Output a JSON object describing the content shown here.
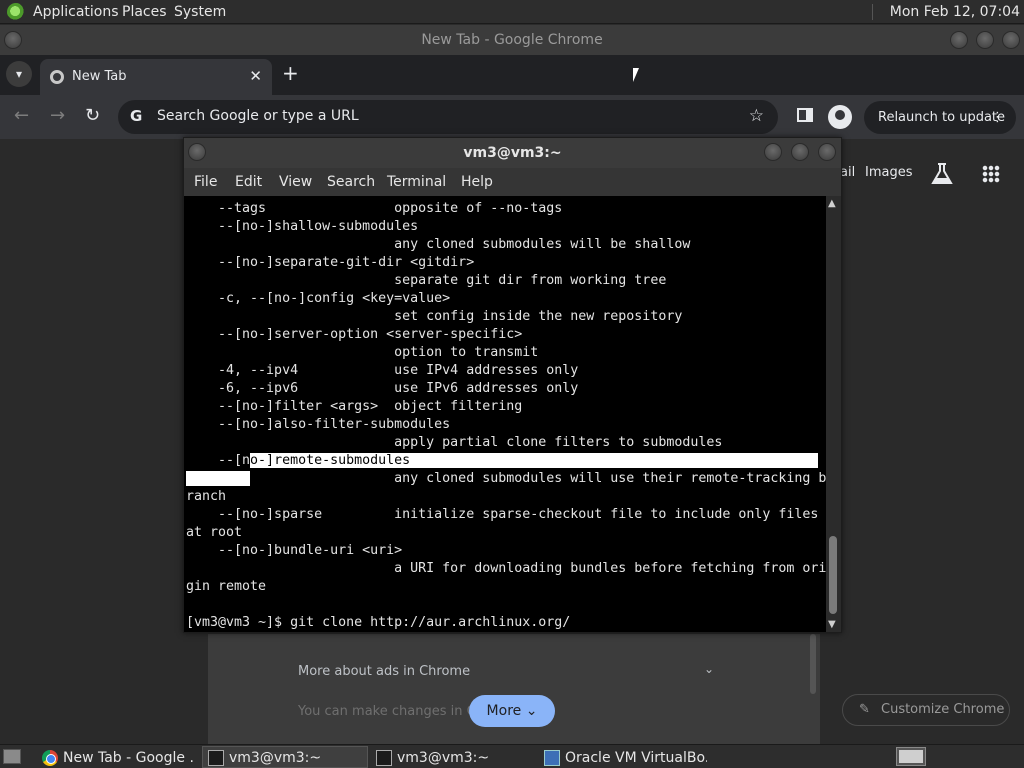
{
  "top_panel": {
    "menus": [
      "Applications",
      "Places",
      "System"
    ],
    "clock": "Mon Feb 12, 07:04"
  },
  "chrome": {
    "window_title": "New Tab - Google Chrome",
    "tab": {
      "label": "New Tab",
      "close": "✕"
    },
    "new_tab": "+",
    "toolbar": {
      "back": "←",
      "forward": "→",
      "reload": "↻",
      "omnibox_placeholder": "Search Google or type a URL",
      "omnibox_g": "G",
      "star": "☆",
      "relaunch_label": "Relaunch to update",
      "relaunch_menu": "⋮"
    },
    "ntp": {
      "partial_link": "ail",
      "images_link": "Images",
      "ads_row": "More about ads in Chrome",
      "ads_chevron": "⌄",
      "faded_text": "You can make changes in Chro",
      "more_button": "More",
      "more_chevron": "⌄",
      "customize_button": "Customize Chrome",
      "customize_icon": "✎"
    }
  },
  "terminal": {
    "title": "vm3@vm3:~",
    "menu": [
      "File",
      "Edit",
      "View",
      "Search",
      "Terminal",
      "Help"
    ],
    "lines": [
      "    --tags                opposite of --no-tags",
      "    --[no-]shallow-submodules",
      "                          any cloned submodules will be shallow",
      "    --[no-]separate-git-dir <gitdir>",
      "                          separate git dir from working tree",
      "    -c, --[no-]config <key=value>",
      "                          set config inside the new repository",
      "    --[no-]server-option <server-specific>",
      "                          option to transmit",
      "    -4, --ipv4            use IPv4 addresses only",
      "    -6, --ipv6            use IPv6 addresses only",
      "    --[no-]filter <args>  object filtering",
      "    --[no-]also-filter-submodules",
      "                          apply partial clone filters to submodules",
      "    --[no-]remote-submodules",
      "                          any cloned submodules will use their remote-tracking b",
      "ranch",
      "    --[no-]sparse         initialize sparse-checkout file to include only files",
      "at root",
      "    --[no-]bundle-uri <uri>",
      "                          a URI for downloading bundles before fetching from ori",
      "gin remote",
      "",
      "[vm3@vm3 ~]$ git clone http://aur.archlinux.org/"
    ]
  },
  "taskbar": {
    "tasks": [
      {
        "label": "New Tab - Google ...",
        "icon": "chrome-icon",
        "active": false
      },
      {
        "label": "vm3@vm3:~",
        "icon": "terminal-icon",
        "active": true
      },
      {
        "label": "vm3@vm3:~",
        "icon": "terminal-icon",
        "active": false
      },
      {
        "label": "Oracle VM VirtualBo...",
        "icon": "virtualbox-icon",
        "active": false
      }
    ]
  }
}
